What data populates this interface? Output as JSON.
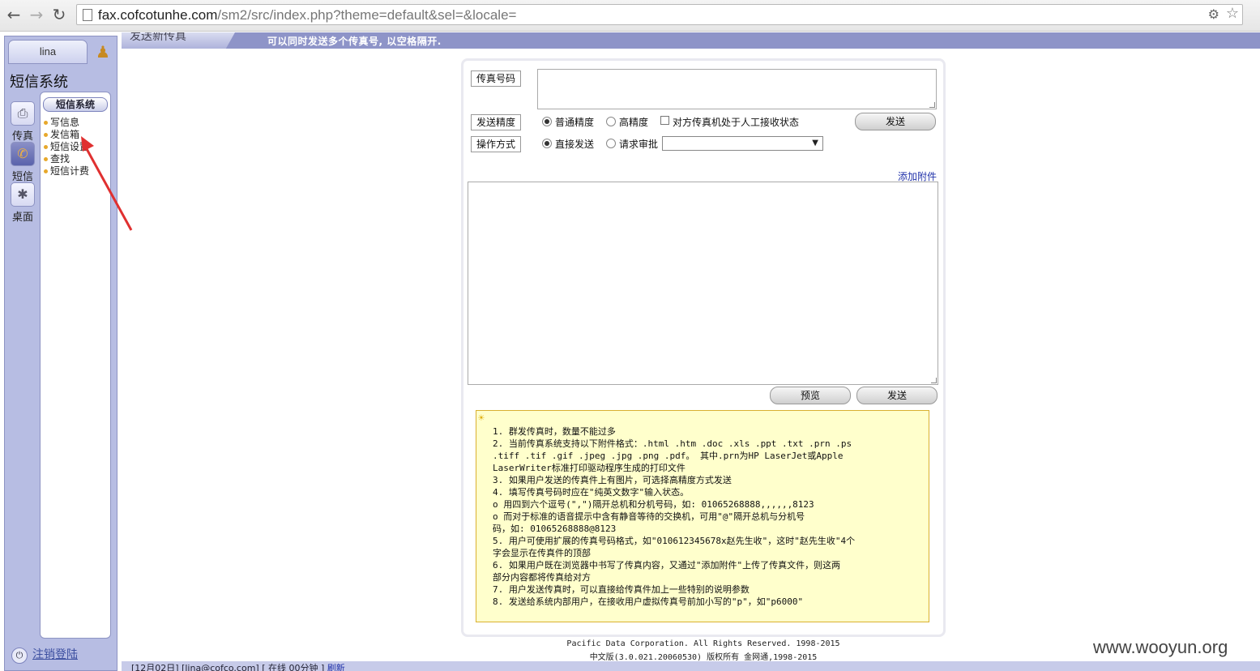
{
  "browser": {
    "url_host": "fax.cofcotunhe.com",
    "url_path": "/sm2/src/index.php?theme=default&sel=&locale="
  },
  "sidebar": {
    "username": "lina",
    "system_title": "短信系统",
    "modules": [
      {
        "label": "传真",
        "icon": "fax-icon"
      },
      {
        "label": "短信",
        "icon": "phone-icon"
      },
      {
        "label": "桌面",
        "icon": "desktop-icon"
      }
    ],
    "menu_header": "短信系统",
    "menu_items": [
      "写信息",
      "发信箱",
      "短信设置",
      "查找",
      "短信计费"
    ],
    "logout_label": "注销登陆"
  },
  "header": {
    "tab_title": "发送新传真",
    "hint": "可以同时发送多个传真号, 以空格隔开."
  },
  "form": {
    "fax_number_label": "传真号码",
    "fax_number_value": "",
    "quality_label": "发送精度",
    "quality_normal": "普通精度",
    "quality_high": "高精度",
    "manual_receive": "对方传真机处于人工接收状态",
    "send_label": "发送",
    "mode_label": "操作方式",
    "mode_direct": "直接发送",
    "mode_approval": "请求审批",
    "approval_select_value": "",
    "add_attachment": "添加附件",
    "body_value": "",
    "preview_label": "预览",
    "send_bottom_label": "发送"
  },
  "notes": [
    "1.      群发传真时，数量不能过多",
    "2.      当前传真系统支持以下附件格式：.html .htm .doc .xls .ppt .txt .prn .ps",
    "   .tiff .tif .gif .jpeg .jpg .png .pdf。 其中.prn为HP LaserJet或Apple",
    "   LaserWriter标准打印驱动程序生成的打印文件",
    "3.      如果用户发送的传真件上有图片，可选择高精度方式发送",
    "4.      填写传真号码时应在\"纯英文数字\"输入状态。",
    "        o     用四到六个逗号(\",\")隔开总机和分机号码，如: 01065268888,,,,,,8123",
    "        o     而对于标准的语音提示中含有静音等待的交换机，可用\"@\"隔开总机与分机号",
    "              码，如: 01065268888@8123",
    "5.      用户可使用扩展的传真号码格式，如\"010612345678x赵先生收\"，这时\"赵先生收\"4个",
    "   字会显示在传真件的顶部",
    "6.      如果用户既在浏览器中书写了传真内容，又通过\"添加附件\"上传了传真文件，则这两",
    "   部分内容都将传真给对方",
    "7.      用户发送传真时，可以直接给传真件加上一些特别的说明参数",
    "8.      发送给系统内部用户，在接收用户虚拟传真号前加小写的\"p\"，如\"p6000\""
  ],
  "footer": {
    "line1": "Pacific Data Corporation. All Rights Reserved. 1998-2015",
    "line2": "中文版(3.0.021.20060530) 版权所有 金网通,1998-2015"
  },
  "statusbar": {
    "text": "[12月02日] [lina@cofco.com] [ 在线 00分钟 ]",
    "refresh": "刷新"
  },
  "watermark": "www.wooyun.org",
  "colors": {
    "sidebar_bg": "#b7bde3",
    "band_bg": "#8e94c8",
    "notes_bg": "#ffffcc",
    "annotation_arrow": "#e03030"
  }
}
